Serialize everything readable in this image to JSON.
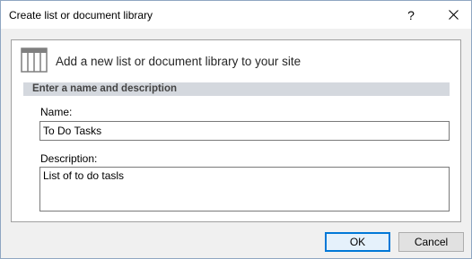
{
  "window": {
    "title": "Create list or document library",
    "help_label": "?"
  },
  "panel": {
    "icon": "list-table-icon",
    "heading": "Add a new list or document library to your site",
    "section_title": "Enter a name and description"
  },
  "form": {
    "name_label": "Name:",
    "name_value": "To Do Tasks",
    "description_label": "Description:",
    "description_value": "List of to do tasls"
  },
  "buttons": {
    "ok_label": "OK",
    "cancel_label": "Cancel"
  },
  "colors": {
    "accent": "#0078d7",
    "section_bar": "#d4d8de",
    "icon_gray": "#7f7f7f"
  }
}
